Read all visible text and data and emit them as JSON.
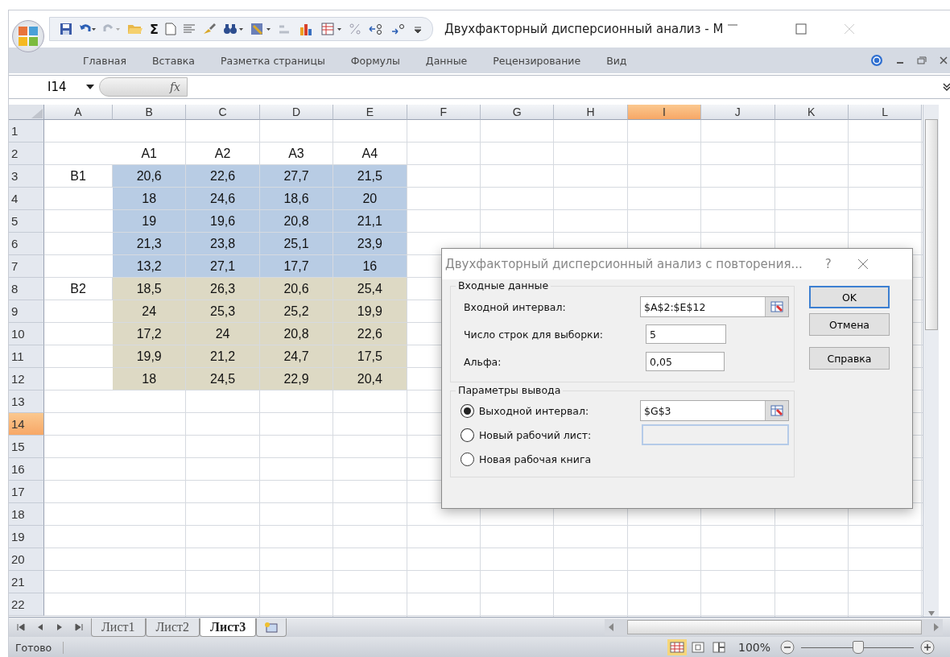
{
  "window": {
    "title": "Двухфакторный дисперсионный анализ - M"
  },
  "quick_access": {
    "sum_symbol": "Σ"
  },
  "ribbon_tabs": [
    {
      "label": "Главная",
      "selected": false
    },
    {
      "label": "Вставка",
      "selected": false
    },
    {
      "label": "Разметка страницы",
      "selected": false
    },
    {
      "label": "Формулы",
      "selected": false
    },
    {
      "label": "Данные",
      "selected": false
    },
    {
      "label": "Рецензирование",
      "selected": false
    },
    {
      "label": "Вид",
      "selected": false
    }
  ],
  "formula_bar": {
    "name_box": "I14",
    "function_symbol": "fx"
  },
  "columns": [
    {
      "label": "A",
      "selected": false
    },
    {
      "label": "B",
      "selected": false
    },
    {
      "label": "C",
      "selected": false
    },
    {
      "label": "D",
      "selected": false
    },
    {
      "label": "E",
      "selected": false
    },
    {
      "label": "F",
      "selected": false
    },
    {
      "label": "G",
      "selected": false
    },
    {
      "label": "H",
      "selected": false
    },
    {
      "label": "I",
      "selected": true
    },
    {
      "label": "J",
      "selected": false
    },
    {
      "label": "K",
      "selected": false
    },
    {
      "label": "L",
      "selected": false
    }
  ],
  "rows": [
    {
      "number": "1",
      "selected": false
    },
    {
      "number": "2",
      "selected": false,
      "values": [
        "A1",
        "A2",
        "A3",
        "A4"
      ]
    },
    {
      "number": "3",
      "selected": false,
      "label": "B1",
      "values": [
        "20,6",
        "22,6",
        "27,7",
        "21,5"
      ],
      "color": "#b8cce4"
    },
    {
      "number": "4",
      "selected": false,
      "values": [
        "18",
        "24,6",
        "18,6",
        "20"
      ],
      "color": "#b8cce4"
    },
    {
      "number": "5",
      "selected": false,
      "values": [
        "19",
        "19,6",
        "20,8",
        "21,1"
      ],
      "color": "#b8cce4"
    },
    {
      "number": "6",
      "selected": false,
      "values": [
        "21,3",
        "23,8",
        "25,1",
        "23,9"
      ],
      "color": "#b8cce4"
    },
    {
      "number": "7",
      "selected": false,
      "values": [
        "13,2",
        "27,1",
        "17,7",
        "16"
      ],
      "color": "#b8cce4"
    },
    {
      "number": "8",
      "selected": false,
      "label": "B2",
      "values": [
        "18,5",
        "26,3",
        "20,6",
        "25,4"
      ],
      "color": "#ddd9c4"
    },
    {
      "number": "9",
      "selected": false,
      "values": [
        "24",
        "25,3",
        "25,2",
        "19,9"
      ],
      "color": "#ddd9c4"
    },
    {
      "number": "10",
      "selected": false,
      "values": [
        "17,2",
        "24",
        "20,8",
        "22,6"
      ],
      "color": "#ddd9c4"
    },
    {
      "number": "11",
      "selected": false,
      "values": [
        "19,9",
        "21,2",
        "24,7",
        "17,5"
      ],
      "color": "#ddd9c4"
    },
    {
      "number": "12",
      "selected": false,
      "values": [
        "18",
        "24,5",
        "22,9",
        "20,4"
      ],
      "color": "#ddd9c4"
    },
    {
      "number": "13",
      "selected": false
    },
    {
      "number": "14",
      "selected": true
    },
    {
      "number": "15",
      "selected": false
    },
    {
      "number": "16",
      "selected": false
    },
    {
      "number": "17",
      "selected": false
    },
    {
      "number": "18",
      "selected": false
    },
    {
      "number": "19",
      "selected": false
    },
    {
      "number": "20",
      "selected": false
    },
    {
      "number": "21",
      "selected": false
    },
    {
      "number": "22",
      "selected": false
    }
  ],
  "sheet_tabs": [
    {
      "label": "Лист1",
      "selected": false
    },
    {
      "label": "Лист2",
      "selected": false
    },
    {
      "label": "Лист3",
      "selected": true
    }
  ],
  "status_bar": {
    "status": "Готово",
    "zoom": "100%",
    "zoom_slider": {
      "level": 0.5
    },
    "views": [
      {
        "kind": "normal",
        "selected": true
      },
      {
        "kind": "layout",
        "selected": false
      },
      {
        "kind": "break",
        "selected": false
      }
    ]
  },
  "dialog": {
    "title": "Двухфакторный дисперсионный анализ с повторения...",
    "help": "?",
    "input_group": {
      "title": "Входные данные",
      "fields": [
        {
          "label": "Входной интервал:",
          "value": "$A$2:$E$12",
          "kind": "range"
        },
        {
          "label": "Число строк для выборки:",
          "value": "5",
          "kind": "short"
        },
        {
          "label": "Альфа:",
          "value": "0,05",
          "kind": "short"
        }
      ]
    },
    "output_group": {
      "title": "Параметры вывода",
      "options": [
        {
          "label": "Выходной интервал:",
          "selected": true,
          "value": "$G$3",
          "kind": "range"
        },
        {
          "label": "Новый рабочий лист:",
          "selected": false,
          "kind": "text"
        },
        {
          "label": "Новая рабочая книга",
          "selected": false,
          "kind": "none"
        }
      ]
    },
    "buttons": [
      {
        "label": "OK",
        "default": true
      },
      {
        "label": "Отмена",
        "default": false
      },
      {
        "label": "Справка",
        "default": false
      }
    ]
  }
}
